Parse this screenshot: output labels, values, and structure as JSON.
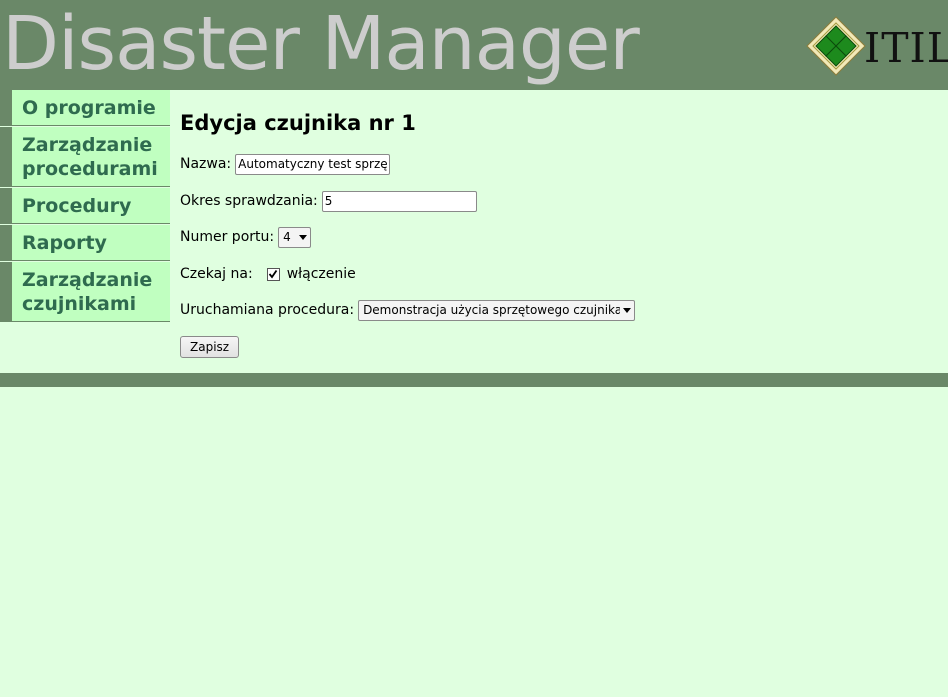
{
  "header": {
    "title": "Disaster Manager",
    "logo_text": "ITIL",
    "logo_icon": "itil-diamond-logo"
  },
  "sidebar": {
    "items": [
      {
        "label_line1": "O programie",
        "label_line2": ""
      },
      {
        "label_line1": "Zarządzanie",
        "label_line2": "procedurami"
      },
      {
        "label_line1": "Procedury",
        "label_line2": ""
      },
      {
        "label_line1": "Raporty",
        "label_line2": ""
      },
      {
        "label_line1": "Zarządzanie",
        "label_line2": "czujnikami"
      }
    ]
  },
  "main": {
    "title": "Edycja czujnika nr 1",
    "form": {
      "name_label": "Nazwa:",
      "name_value": "Automatyczny test sprzęt",
      "period_label": "Okres sprawdzania:",
      "period_value": "5",
      "port_label": "Numer portu:",
      "port_value": "4",
      "wait_label": "Czekaj na:",
      "wait_checked": true,
      "wait_option_label": "włączenie",
      "procedure_label": "Uruchamiana procedura:",
      "procedure_value": "Demonstracja użycia sprzętowego czujnika",
      "save_label": "Zapisz"
    }
  },
  "colors": {
    "header_bg": "#6a8868",
    "page_bg": "#e0ffe0",
    "nav_bg": "#c0ffc0",
    "nav_text": "#2f6b4f",
    "title_text": "#cdcdcd"
  }
}
